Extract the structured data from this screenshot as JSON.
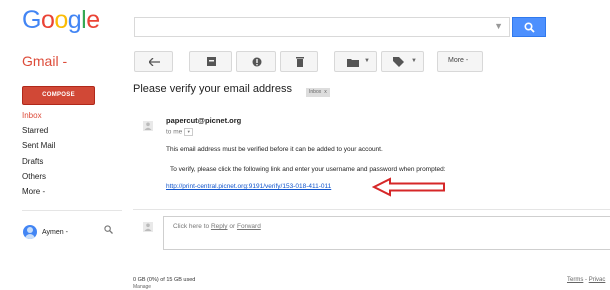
{
  "header": {
    "logo_letters": [
      {
        "char": "G",
        "color": "#4285f4"
      },
      {
        "char": "o",
        "color": "#ea4335"
      },
      {
        "char": "o",
        "color": "#fbbc05"
      },
      {
        "char": "g",
        "color": "#4285f4"
      },
      {
        "char": "l",
        "color": "#34a853"
      },
      {
        "char": "e",
        "color": "#ea4335"
      }
    ],
    "search_value": "",
    "search_icon": "search-icon"
  },
  "app_switch": {
    "label": "Gmail -"
  },
  "toolbar": {
    "back_icon": "back-arrow-icon",
    "archive_icon": "archive-icon",
    "spam_icon": "report-spam-icon",
    "delete_icon": "trash-icon",
    "move_icon": "folder-icon",
    "labels_icon": "label-icon",
    "more_label": "More -"
  },
  "sidebar": {
    "compose_label": "COMPOSE",
    "items": [
      {
        "label": "Inbox",
        "active": true
      },
      {
        "label": "Starred"
      },
      {
        "label": "Sent Mail"
      },
      {
        "label": "Drafts"
      },
      {
        "label": "Others"
      },
      {
        "label": "More -"
      }
    ],
    "chat_user": "Aymen -",
    "chat_search_icon": "search-icon"
  },
  "message": {
    "subject": "Please verify your email address",
    "inbox_badge": "Inbox",
    "badge_close": "x",
    "sender": "papercut@picnet.org",
    "to": "to me",
    "line1": "This email address must be verified before it can be added to your account.",
    "line2": "To verify, please click the following link and enter your username and password when prompted:",
    "link": "http://print-central.picnet.org:9191/verify/153-018-411-011",
    "annotation_color": "#d62728"
  },
  "reply": {
    "prefix": "Click here to ",
    "reply_link": "Reply",
    "or_text": " or ",
    "forward_link": "Forward"
  },
  "footer": {
    "usage": "0 GB (0%) of 15 GB used",
    "manage": "Manage",
    "terms": "Terms",
    "sep": " - ",
    "privacy": "Privac"
  }
}
